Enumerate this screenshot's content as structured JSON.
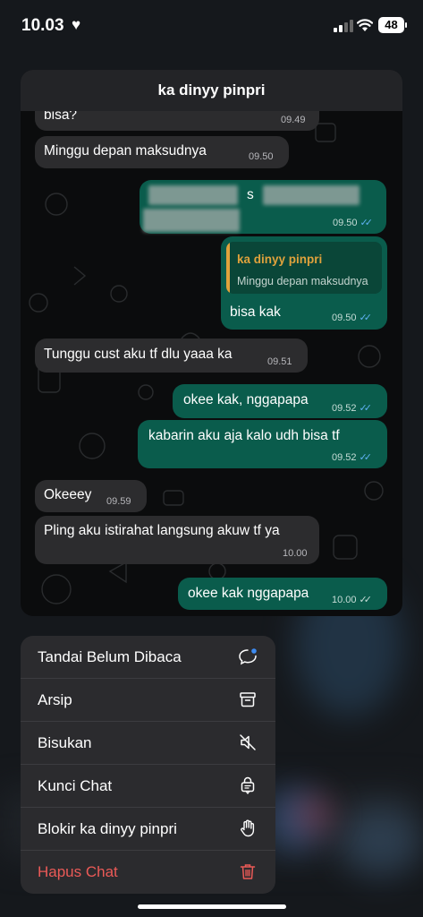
{
  "status_bar": {
    "time": "10.03",
    "battery": "48"
  },
  "chat": {
    "title": "ka dinyy pinpri",
    "messages": [
      {
        "dir": "in",
        "text": "bisa?",
        "time": "09.49"
      },
      {
        "dir": "in",
        "text": "Minggu depan maksudnya",
        "time": "09.50"
      },
      {
        "dir": "out",
        "text": "s",
        "time": "09.50"
      },
      {
        "dir": "out",
        "quote_name": "ka dinyy pinpri",
        "quote_text": "Minggu depan maksudnya",
        "text": "bisa kak",
        "time": "09.50"
      },
      {
        "dir": "in",
        "text": "Tunggu cust aku tf dlu yaaa ka",
        "time": "09.51"
      },
      {
        "dir": "out",
        "text": "okee kak, nggapapa",
        "time": "09.52"
      },
      {
        "dir": "out",
        "text": "kabarin aku aja kalo udh bisa tf",
        "time": "09.52"
      },
      {
        "dir": "in",
        "text": "Okeeey",
        "time": "09.59"
      },
      {
        "dir": "in",
        "text": "Pling aku istirahat langsung akuw tf ya",
        "time": "10.00"
      },
      {
        "dir": "out",
        "text": "okee kak nggapapa",
        "time": "10.00"
      }
    ]
  },
  "menu": {
    "items": [
      {
        "label": "Tandai Belum Dibaca",
        "icon": "unread-chat-icon"
      },
      {
        "label": "Arsip",
        "icon": "archive-icon"
      },
      {
        "label": "Bisukan",
        "icon": "mute-icon"
      },
      {
        "label": "Kunci Chat",
        "icon": "lock-chat-icon"
      },
      {
        "label": "Blokir ka dinyy pinpri",
        "icon": "hand-block-icon"
      },
      {
        "label": "Hapus Chat",
        "icon": "trash-icon"
      }
    ]
  },
  "colors": {
    "incoming": "#2c2c2e",
    "outgoing": "#0a5c4c",
    "danger": "#eb5a57",
    "read_ticks": "#5fb1f2"
  }
}
